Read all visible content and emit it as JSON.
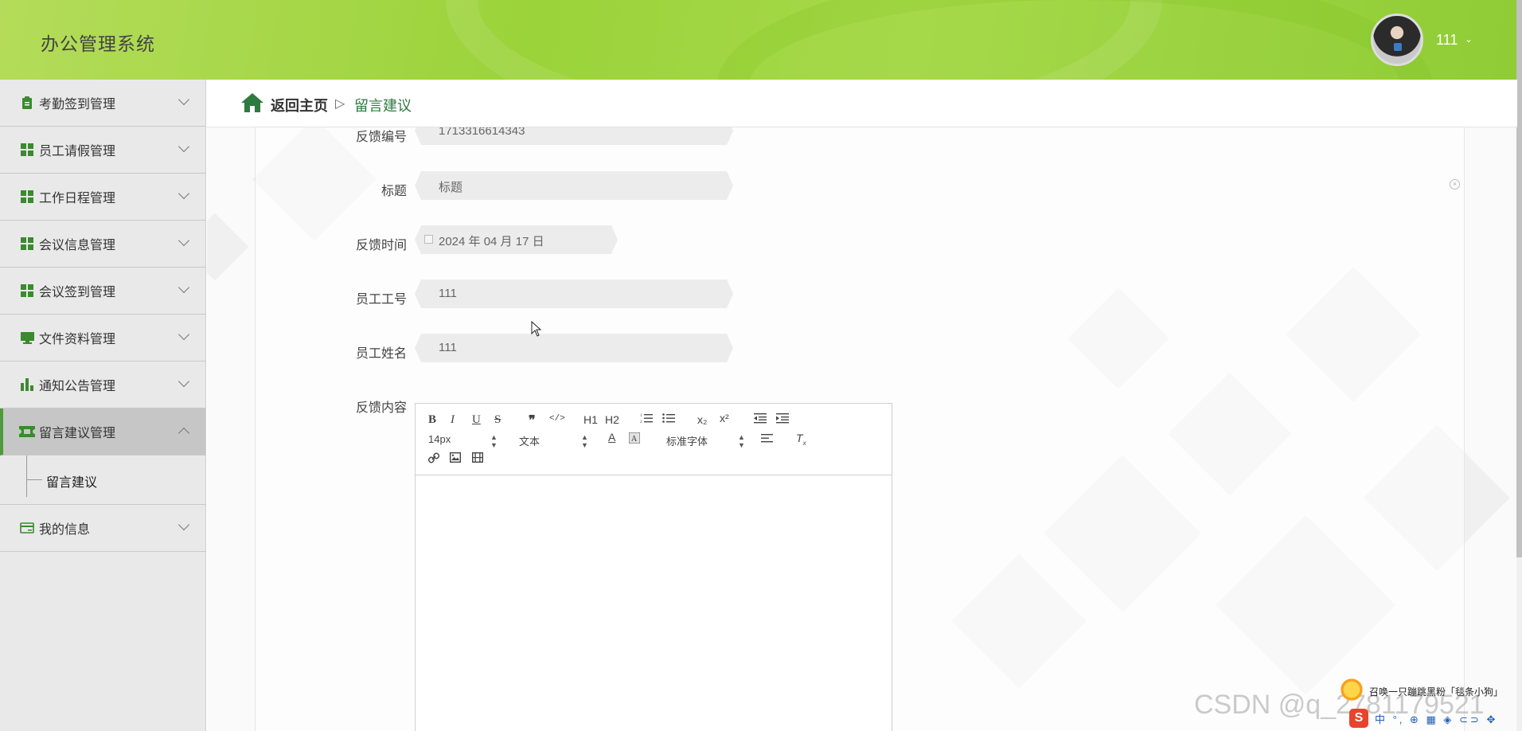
{
  "app": {
    "title": "办公管理系统"
  },
  "user": {
    "name": "111",
    "caret": "⌄"
  },
  "sidebar": {
    "items": [
      {
        "label": "考勤签到管理",
        "icon": "clipboard-icon"
      },
      {
        "label": "员工请假管理",
        "icon": "grid-icon"
      },
      {
        "label": "工作日程管理",
        "icon": "grid-icon"
      },
      {
        "label": "会议信息管理",
        "icon": "grid-icon"
      },
      {
        "label": "会议签到管理",
        "icon": "grid-icon"
      },
      {
        "label": "文件资料管理",
        "icon": "monitor-icon"
      },
      {
        "label": "通知公告管理",
        "icon": "bar-chart-icon"
      },
      {
        "label": "留言建议管理",
        "icon": "ticket-icon",
        "active": true
      },
      {
        "label": "我的信息",
        "icon": "card-icon"
      }
    ],
    "submenu": {
      "label": "留言建议"
    }
  },
  "breadcrumb": {
    "home": "返回主页",
    "separator": "▷",
    "current": "留言建议"
  },
  "form": {
    "feedback_no": {
      "label": "反馈编号",
      "value": "1713316614343"
    },
    "title": {
      "label": "标题",
      "value": "标题"
    },
    "time": {
      "label": "反馈时间",
      "value": "2024 年 04 月 17 日"
    },
    "emp_no": {
      "label": "员工工号",
      "value": "111"
    },
    "emp_name": {
      "label": "员工姓名",
      "value": "111"
    },
    "content": {
      "label": "反馈内容"
    }
  },
  "editor": {
    "row1": [
      "B",
      "I",
      "U",
      "S",
      "❞",
      "</>",
      "H1",
      "H2",
      "ol",
      "ul",
      "x₂",
      "x²",
      "outdent",
      "indent"
    ],
    "size_select": "14px",
    "format_select": "文本",
    "font_select": "标准字体",
    "color_label": "A"
  },
  "watermark": "CSDN @q_2781179521",
  "ime": {
    "note": "召唤一只蹦跳黑粉「毯条小狗」",
    "logo": "S",
    "bar": "中 °, ⊕ ▦ ◈ ⊂⊃ ✥"
  },
  "colors": {
    "header_green": "#9bd33a",
    "accent_green": "#3a8a2e",
    "sidebar_bg": "#e9e9e9"
  }
}
